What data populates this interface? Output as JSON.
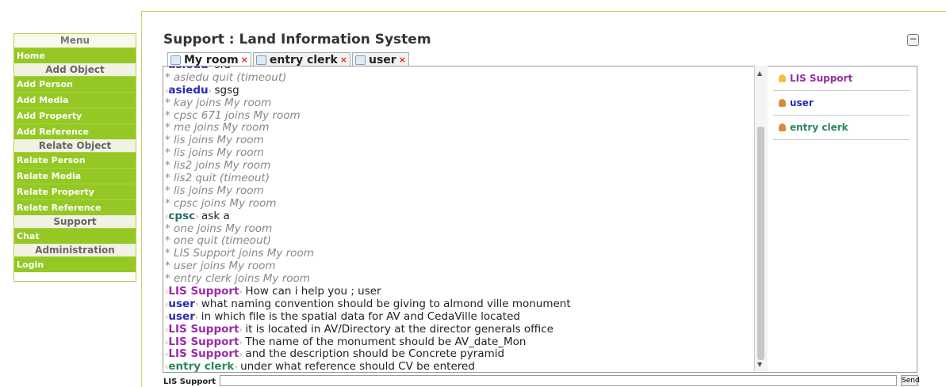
{
  "menu": {
    "title": "Menu",
    "home": "Home",
    "add_header": "Add Object",
    "add_person": "Add Person",
    "add_media": "Add Media",
    "add_property": "Add Property",
    "add_reference": "Add Reference",
    "relate_header": "Relate Object",
    "relate_person": "Relate Person",
    "relate_media": "Relate Media",
    "relate_property": "Relate Property",
    "relate_reference": "Relate Reference",
    "support_header": "Support",
    "chat": "Chat",
    "admin_header": "Administration",
    "login": "Login"
  },
  "header": {
    "title": "Support : Land Information System",
    "collapse": "−"
  },
  "tabs": [
    {
      "label": "My room",
      "close": "×"
    },
    {
      "label": "entry clerk",
      "close": "×"
    },
    {
      "label": "user",
      "close": "×"
    }
  ],
  "messages": [
    {
      "nick": "asiedu",
      "text": "sfd",
      "color": "#2b2bb0"
    },
    {
      "system": "* asiedu quit (timeout)"
    },
    {
      "nick": "asiedu",
      "text": "sgsg",
      "color": "#2b2bb0"
    },
    {
      "system": "* kay joins My room"
    },
    {
      "system": "* cpsc 671 joins My room"
    },
    {
      "system": "* me joins My room"
    },
    {
      "system": "* lis joins My room"
    },
    {
      "system": "* lis joins My room"
    },
    {
      "system": "* lis2 joins My room"
    },
    {
      "system": "* lis2 quit (timeout)"
    },
    {
      "system": "* lis joins My room"
    },
    {
      "system": "* cpsc joins My room"
    },
    {
      "nick": "cpsc",
      "text": "ask a",
      "color": "#2a6a6a"
    },
    {
      "system": "* one joins My room"
    },
    {
      "system": "* one quit (timeout)"
    },
    {
      "system": "* LIS Support joins My room"
    },
    {
      "system": "* user joins My room"
    },
    {
      "system": "* entry clerk joins My room"
    },
    {
      "nick": "LIS Support",
      "text": "How can i help you ; user",
      "color": "#9b2aa8"
    },
    {
      "nick": "user",
      "text": "what naming convention should be giving to almond ville monument",
      "color": "#2b2bb0"
    },
    {
      "nick": "user",
      "text": "in which file is the spatial data for AV and CedaVille located",
      "color": "#2b2bb0"
    },
    {
      "nick": "LIS Support",
      "text": "it is located in AV/Directory at the director generals office",
      "color": "#9b2aa8"
    },
    {
      "nick": "LIS Support",
      "text": "The name of the monument should be AV_date_Mon",
      "color": "#9b2aa8"
    },
    {
      "nick": "LIS Support",
      "text": "and the description should be Concrete pyramid",
      "color": "#9b2aa8"
    },
    {
      "nick": "entry clerk",
      "text": "under what reference should CV be entered",
      "color": "#2a8a5a"
    }
  ],
  "users": [
    {
      "name": "LIS Support",
      "color": "#9b2aa8",
      "icon": "shield-icon"
    },
    {
      "name": "user",
      "color": "#2b2bb0",
      "icon": "person-icon"
    },
    {
      "name": "entry clerk",
      "color": "#2a8a5a",
      "icon": "person-icon"
    }
  ],
  "input": {
    "label": "LIS Support",
    "value": "",
    "send": "Send"
  }
}
